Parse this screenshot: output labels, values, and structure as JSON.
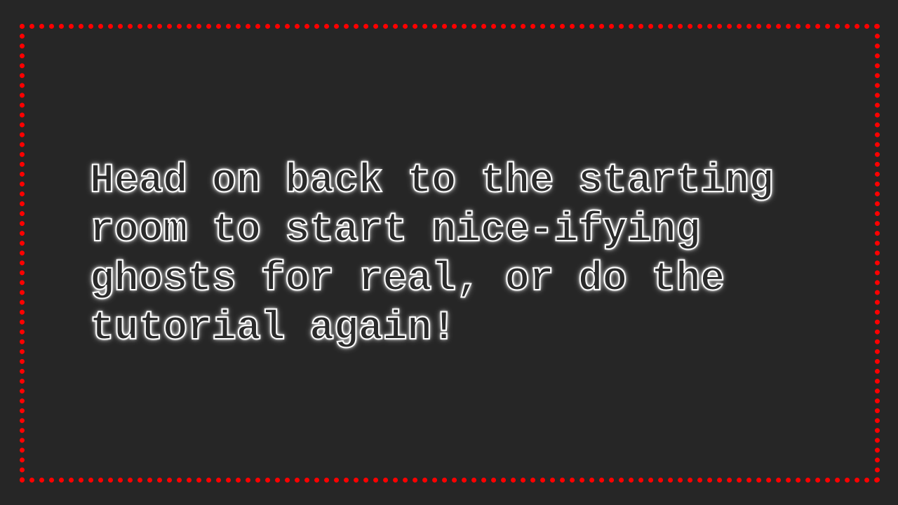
{
  "dialog": {
    "lines": [
      "Head on back to the starting",
      "room to start nice-ifying",
      "ghosts for real, or do the",
      "tutorial again!"
    ]
  },
  "colors": {
    "background": "#262626",
    "frame_border": "#ff0000",
    "text_outline": "#ffffff"
  }
}
